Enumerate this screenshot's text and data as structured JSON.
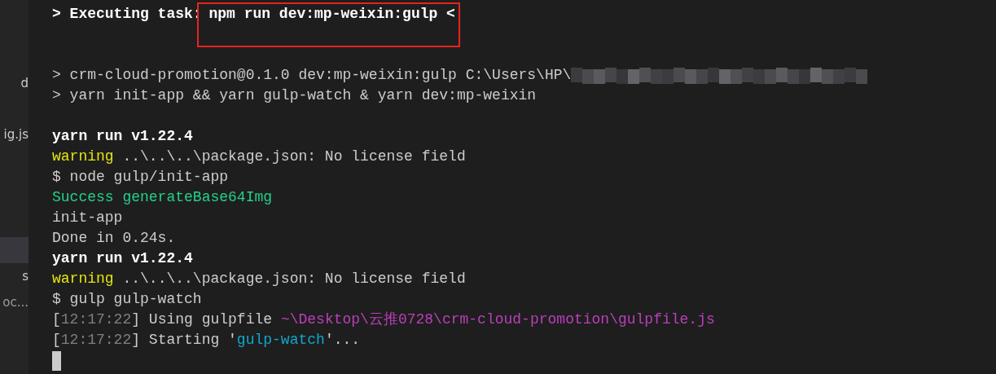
{
  "sidebar": {
    "items": [
      {
        "label": "d",
        "selected": false
      },
      {
        "label": "ig.js",
        "selected": false
      },
      {
        "selected": true
      },
      {
        "label": "s",
        "selected": false
      },
      {
        "label": "oc...",
        "selected": false
      }
    ]
  },
  "terminal": {
    "lines": [
      {
        "kind": "text",
        "segments": [
          {
            "text": "> Executing task: ",
            "kind": "bold"
          },
          {
            "text": "npm run dev:mp-weixin:gulp <",
            "kind": "bold",
            "highlighted": true
          }
        ]
      },
      {
        "kind": "blank"
      },
      {
        "kind": "blank"
      },
      {
        "kind": "text",
        "redacted": true,
        "segments": [
          {
            "text": "> crm-cloud-promotion@0.1.0 dev:mp-weixin:gulp C:\\Users\\HP\\",
            "kind": "plain"
          }
        ]
      },
      {
        "kind": "text",
        "segments": [
          {
            "text": "> yarn init-app && yarn gulp-watch & yarn dev:mp-weixin",
            "kind": "plain"
          }
        ]
      },
      {
        "kind": "blank"
      },
      {
        "kind": "text",
        "segments": [
          {
            "text": "yarn run v1.22.4",
            "kind": "bold"
          }
        ]
      },
      {
        "kind": "text",
        "segments": [
          {
            "text": "warning",
            "kind": "warning"
          },
          {
            "text": " ..\\..\\..\\package.json: No license field",
            "kind": "plain"
          }
        ]
      },
      {
        "kind": "text",
        "segments": [
          {
            "text": "$ node gulp/init-app",
            "kind": "plain"
          }
        ]
      },
      {
        "kind": "text",
        "segments": [
          {
            "text": "Success generateBase64Img",
            "kind": "success"
          }
        ]
      },
      {
        "kind": "text",
        "segments": [
          {
            "text": "init-app",
            "kind": "plain"
          }
        ]
      },
      {
        "kind": "text",
        "segments": [
          {
            "text": "Done in 0.24s.",
            "kind": "plain"
          }
        ]
      },
      {
        "kind": "text",
        "segments": [
          {
            "text": "yarn run v1.22.4",
            "kind": "bold"
          }
        ]
      },
      {
        "kind": "text",
        "segments": [
          {
            "text": "warning",
            "kind": "warning"
          },
          {
            "text": " ..\\..\\..\\package.json: No license field",
            "kind": "plain"
          }
        ]
      },
      {
        "kind": "text",
        "segments": [
          {
            "text": "$ gulp gulp-watch",
            "kind": "plain"
          }
        ]
      },
      {
        "kind": "text",
        "segments": [
          {
            "text": "[",
            "kind": "plain"
          },
          {
            "text": "12:17:22",
            "kind": "time"
          },
          {
            "text": "] Using gulpfile ",
            "kind": "plain"
          },
          {
            "text": "~\\Desktop\\云推0728\\crm-cloud-promotion\\gulpfile.js",
            "kind": "path"
          }
        ]
      },
      {
        "kind": "text",
        "segments": [
          {
            "text": "[",
            "kind": "plain"
          },
          {
            "text": "12:17:22",
            "kind": "time"
          },
          {
            "text": "] Starting '",
            "kind": "plain"
          },
          {
            "text": "gulp-watch",
            "kind": "quote"
          },
          {
            "text": "'...",
            "kind": "plain"
          }
        ]
      },
      {
        "kind": "cursor"
      }
    ]
  }
}
